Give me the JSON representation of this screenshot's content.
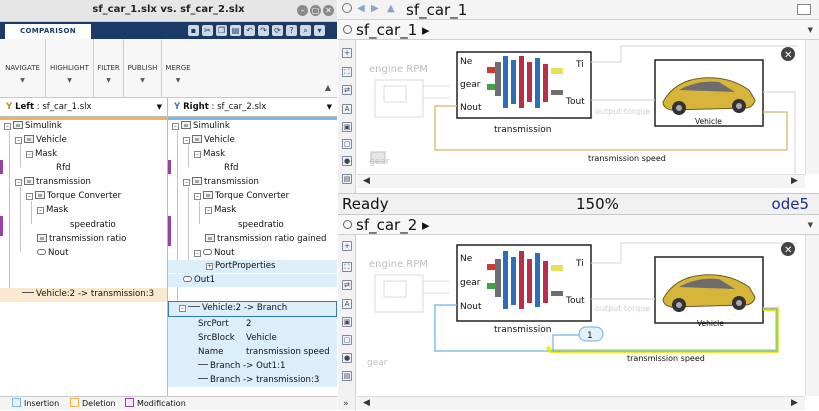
{
  "comparison": {
    "window_title": "sf_car_1.slx vs. sf_car_2.slx",
    "tab": "COMPARISON",
    "ribbon_groups": [
      "NAVIGATE",
      "HIGHLIGHT",
      "FILTER",
      "PUBLISH",
      "MERGE"
    ],
    "left_header": {
      "prefix": "Left",
      "file": " : sf_car_1.slx"
    },
    "right_header": {
      "prefix": "Right",
      "file": " : sf_car_2.slx"
    },
    "left_tree": [
      "Simulink",
      "Vehicle",
      "Mask",
      "Rfd",
      "transmission",
      "Torque Converter",
      "Mask",
      "speedratio",
      "transmission ratio",
      "Nout",
      "Vehicle:2 -> transmission:3"
    ],
    "right_tree": [
      "Simulink",
      "Vehicle",
      "Mask",
      "Rfd",
      "transmission",
      "Torque Converter",
      "Mask",
      "speedratio",
      "transmission ratio gained",
      "Nout",
      "PortProperties",
      "Out1",
      "Vehicle:2 -> Branch"
    ],
    "props": [
      {
        "key": "SrcPort",
        "value": "2"
      },
      {
        "key": "SrcBlock",
        "value": "Vehicle"
      },
      {
        "key": "Name",
        "value": "transmission speed"
      }
    ],
    "branches": [
      "Branch -> Out1:1",
      "Branch -> transmission:3"
    ],
    "legend": {
      "insertion": "Insertion",
      "deletion": "Deletion",
      "modification": "Modification"
    },
    "colors": {
      "insertion": "#79b8e6",
      "deletion": "#f0b35a",
      "modification": "#9b3fa8",
      "tab_bg": "#1b3a66"
    }
  },
  "simulink": {
    "model_title": "sf_car_1",
    "top": {
      "breadcrumb": "sf_car_1",
      "blocks": {
        "input": "engine RPM",
        "gear_block": "gear",
        "transmission": "transmission",
        "vehicle": "Vehicle"
      },
      "ports_in": [
        "Ne",
        "gear",
        "Nout"
      ],
      "ports_out": [
        "Ti",
        "Tout"
      ],
      "signals": {
        "output_torque": "output torque",
        "transmission_speed": "transmission speed"
      }
    },
    "status": {
      "state": "Ready",
      "zoom": "150%",
      "solver": "ode5"
    },
    "bottom": {
      "breadcrumb": "sf_car_2",
      "blocks": {
        "input": "engine RPM",
        "gear_block": "gear",
        "transmission": "transmission",
        "vehicle": "Vehicle",
        "outport_number": "1"
      },
      "ports_in": [
        "Ne",
        "gear",
        "Nout"
      ],
      "ports_out": [
        "Ti",
        "Tout"
      ],
      "signals": {
        "output_torque": "output torque",
        "transmission_speed": "transmission speed"
      }
    },
    "icons": {
      "back": "back-arrow-icon",
      "forward": "forward-arrow-icon",
      "up": "up-arrow-icon",
      "close": "close-icon",
      "more": "more-icon"
    },
    "colors": {
      "highlight": "#e8e800",
      "signal": "#6cb3e0",
      "legacy_signal": "#d6b26a"
    }
  }
}
